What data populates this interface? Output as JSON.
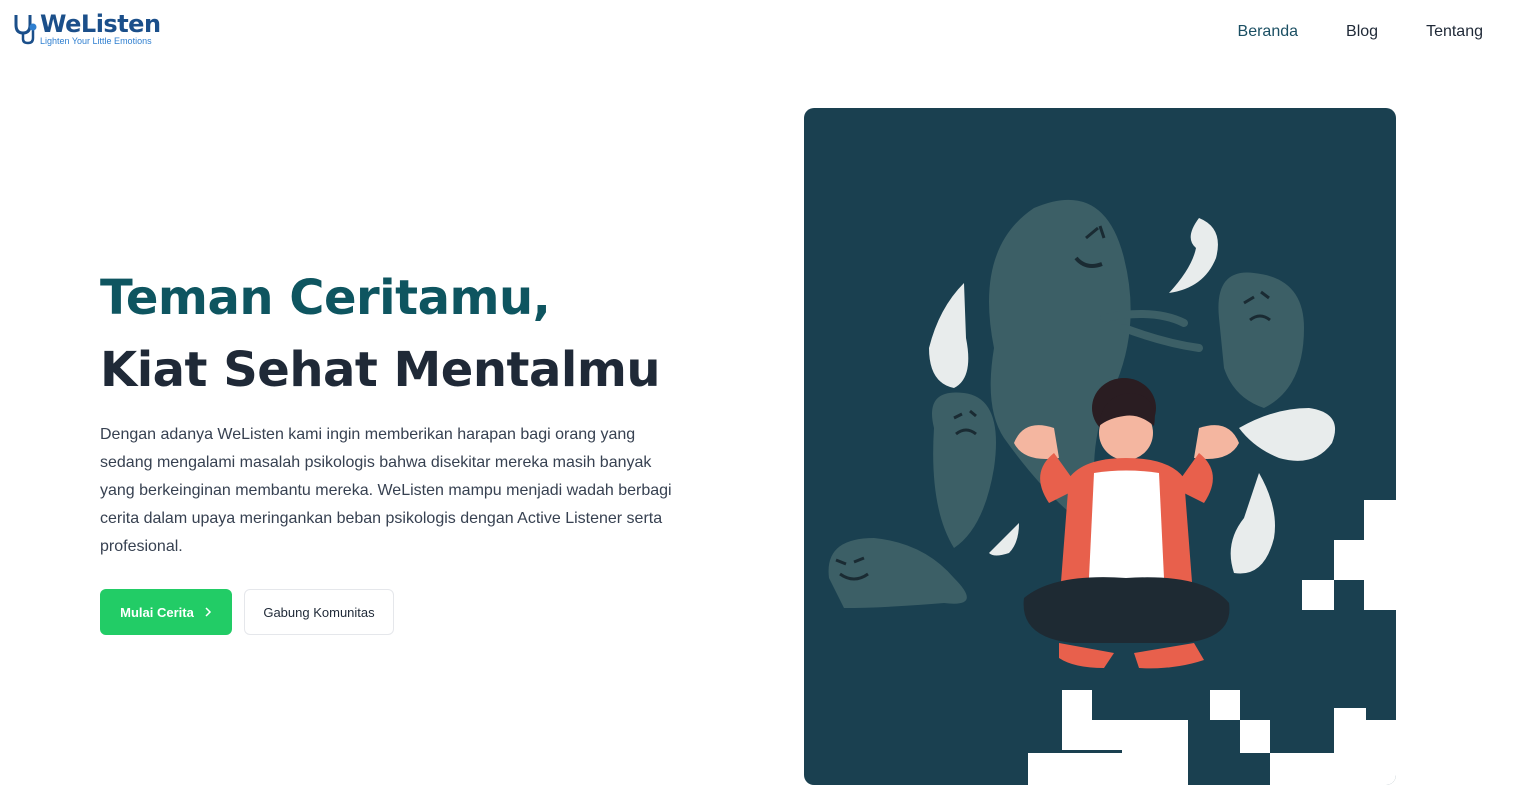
{
  "header": {
    "brand": "WeListen",
    "tagline": "Lighten Your Little Emotions",
    "nav": [
      {
        "label": "Beranda",
        "active": true
      },
      {
        "label": "Blog",
        "active": false
      },
      {
        "label": "Tentang",
        "active": false
      }
    ]
  },
  "hero": {
    "title_line1": "Teman Ceritamu,",
    "title_line2": "Kiat Sehat Mentalmu",
    "description": "Dengan adanya WeListen kami ingin memberikan harapan bagi orang yang sedang mengalami masalah psikologis bahwa disekitar mereka masih banyak yang berkeinginan membantu mereka. WeListen mampu menjadi wadah berbagi cerita dalam upaya meringankan beban psikologis dengan Active Listener serta profesional.",
    "primary_button": "Mulai Cerita",
    "primary_icon": "chevron-right-icon",
    "secondary_button": "Gabung Komunitas"
  },
  "colors": {
    "title_accent": "#0e5560",
    "primary_button": "#22cc66",
    "illustration_bg": "#1a4050",
    "brand": "#1b4f8a"
  }
}
